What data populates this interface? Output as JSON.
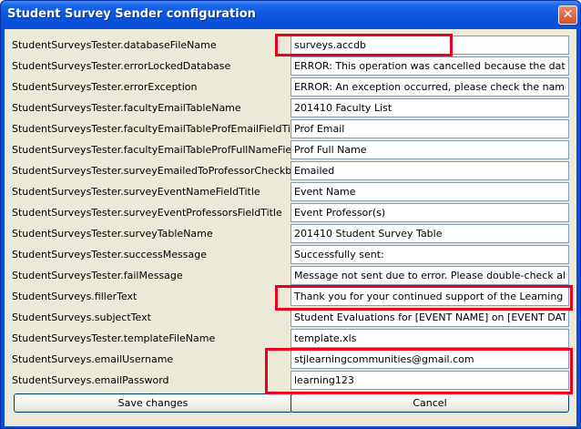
{
  "window": {
    "title": "Student Survey Sender configuration",
    "close_glyph": "✕"
  },
  "settings": [
    {
      "label": "StudentSurveysTester.databaseFileName",
      "value": "surveys.accdb"
    },
    {
      "label": "StudentSurveysTester.errorLockedDatabase",
      "value": "ERROR: This operation was cancelled because the database is"
    },
    {
      "label": "StudentSurveysTester.errorException",
      "value": "ERROR: An exception occurred, please check the names and lo"
    },
    {
      "label": "StudentSurveysTester.facultyEmailTableName",
      "value": "201410 Faculty List"
    },
    {
      "label": "StudentSurveysTester.facultyEmailTableProfEmailFieldTitle",
      "value": "Prof Email"
    },
    {
      "label": "StudentSurveysTester.facultyEmailTableProfFullNameFieldTitle",
      "value": "Prof Full Name"
    },
    {
      "label": "StudentSurveysTester.surveyEmailedToProfessorCheckboxTitle",
      "value": "Emailed"
    },
    {
      "label": "StudentSurveysTester.surveyEventNameFieldTitle",
      "value": "Event Name"
    },
    {
      "label": "StudentSurveysTester.surveyEventProfessorsFieldTitle",
      "value": "Event Professor(s)"
    },
    {
      "label": "StudentSurveysTester.surveyTableName",
      "value": "201410 Student Survey Table"
    },
    {
      "label": "StudentSurveysTester.successMessage",
      "value": "Successfully sent:"
    },
    {
      "label": "StudentSurveysTester.failMessage",
      "value": "Message not sent due to error. Please double-check all input da"
    },
    {
      "label": "StudentSurveys.fillerText",
      "value": "Thank you for your continued support of the Learning Commun"
    },
    {
      "label": "StudentSurveys.subjectText",
      "value": "Student Evaluations for [EVENT NAME] on [EVENT DATE]"
    },
    {
      "label": "StudentSurveysTester.templateFileName",
      "value": "template.xls"
    },
    {
      "label": "StudentSurveys.emailUsername",
      "value": "stjlearningcommunities@gmail.com"
    },
    {
      "label": "StudentSurveys.emailPassword",
      "value": "learning123"
    }
  ],
  "buttons": {
    "save_label": "Save changes",
    "cancel_label": "Cancel"
  },
  "colors": {
    "highlight": "#e8001c",
    "title_bar": "#0a4fd8",
    "dialog_bg": "#ece9d8"
  }
}
